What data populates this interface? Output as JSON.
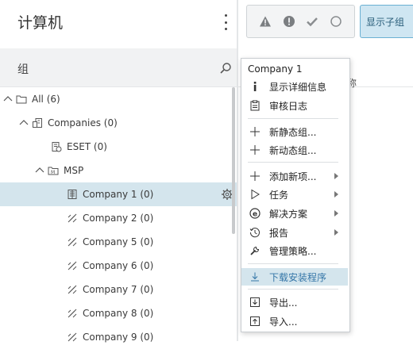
{
  "left_panel": {
    "title": "计算机",
    "group_label": "组",
    "tree": [
      {
        "label": "All (6)",
        "icon": "folder-icon",
        "expanded": true
      },
      {
        "label": "Companies (0)",
        "icon": "companies-icon",
        "expanded": true
      },
      {
        "label": "ESET (0)",
        "icon": "eset-group-icon"
      },
      {
        "label": "MSP",
        "icon": "msp-icon",
        "expanded": true
      },
      {
        "label": "Company 1 (0)",
        "icon": "company-building-icon",
        "selected": true
      },
      {
        "label": "Company 2 (0)",
        "icon": "dynamic-group-icon"
      },
      {
        "label": "Company 5 (0)",
        "icon": "dynamic-group-icon"
      },
      {
        "label": "Company 6 (0)",
        "icon": "dynamic-group-icon"
      },
      {
        "label": "Company 7 (0)",
        "icon": "dynamic-group-icon"
      },
      {
        "label": "Company 8 (0)",
        "icon": "dynamic-group-icon"
      },
      {
        "label": "Company 9 (0)",
        "icon": "dynamic-group-icon"
      }
    ]
  },
  "toolbar": {
    "filter_icons": [
      "warning-icon",
      "error-icon",
      "check-icon",
      "circle-icon"
    ],
    "show_subgroups": "显示子组"
  },
  "right_panel": {
    "column_name": "名称"
  },
  "context_menu": {
    "title": "Company 1",
    "items": [
      {
        "label": "显示详细信息",
        "icon": "info-icon"
      },
      {
        "label": "审核日志",
        "icon": "audit-log-icon"
      },
      {
        "label": "新静态组...",
        "icon": "plus-icon"
      },
      {
        "label": "新动态组...",
        "icon": "plus-icon"
      },
      {
        "label": "添加新项...",
        "icon": "plus-icon",
        "submenu": true
      },
      {
        "label": "任务",
        "icon": "play-icon",
        "submenu": true
      },
      {
        "label": "解决方案",
        "icon": "e-icon",
        "submenu": true
      },
      {
        "label": "报告",
        "icon": "history-icon",
        "submenu": true
      },
      {
        "label": "管理策略...",
        "icon": "wrench-icon"
      },
      {
        "label": "下载安装程序",
        "icon": "download-icon",
        "highlighted": true
      },
      {
        "label": "导出...",
        "icon": "export-icon"
      },
      {
        "label": "导入...",
        "icon": "import-icon"
      }
    ]
  },
  "colors": {
    "selection": "#d4e5ed",
    "accent": "#3576a8"
  }
}
